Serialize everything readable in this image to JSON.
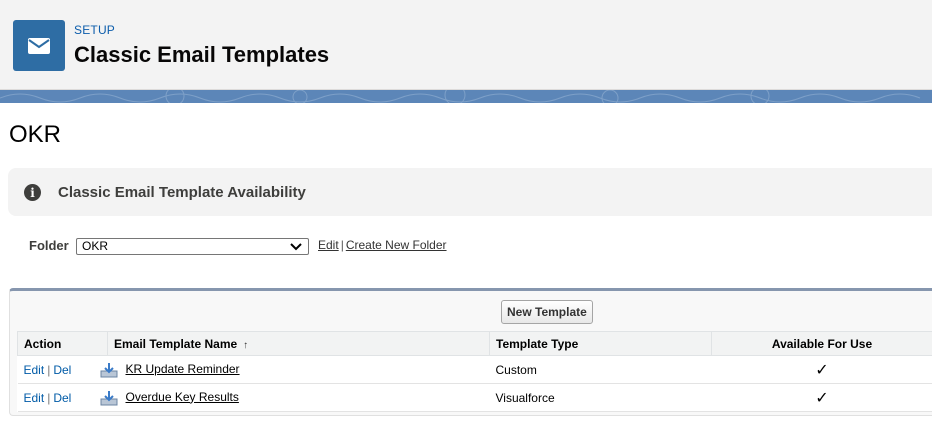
{
  "header": {
    "eyebrow": "SETUP",
    "title": "Classic Email Templates",
    "icon": "envelope-icon"
  },
  "folder_heading": "OKR",
  "availability": {
    "text": "Classic Email Template Availability",
    "icon": "info-icon"
  },
  "folder_selector": {
    "label": "Folder",
    "selected": "OKR",
    "edit_link": "Edit",
    "create_link": "Create New Folder",
    "separator": "|"
  },
  "table": {
    "new_button": "New Template",
    "columns": {
      "action": "Action",
      "name": "Email Template Name",
      "name_sort_indicator": "↑",
      "type": "Template Type",
      "available": "Available For Use"
    },
    "rows": [
      {
        "edit": "Edit",
        "sep": "|",
        "del": "Del",
        "name": "KR Update Reminder",
        "type": "Custom",
        "available": "✓"
      },
      {
        "edit": "Edit",
        "sep": "|",
        "del": "Del",
        "name": "Overdue Key Results",
        "type": "Visualforce",
        "available": "✓"
      }
    ]
  },
  "colors": {
    "header_icon_bg": "#2e6da4",
    "band": "#5c86b8",
    "eyebrow": "#0b5cab",
    "link": "#015ba7"
  }
}
